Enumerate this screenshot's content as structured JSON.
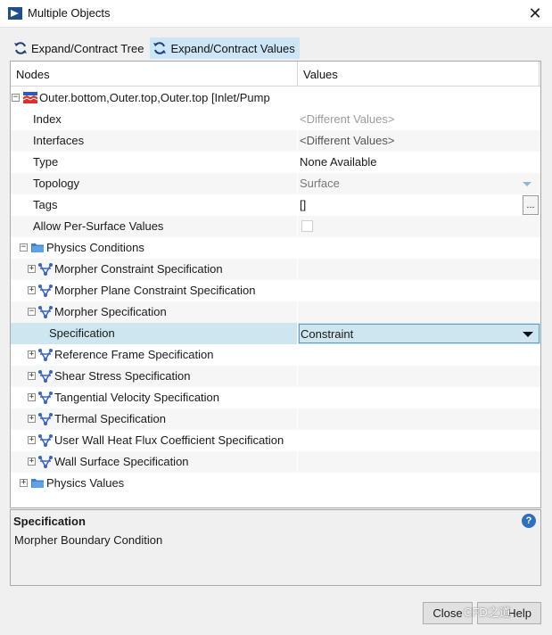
{
  "window": {
    "title": "Multiple Objects"
  },
  "toolbar": {
    "expand_tree_label": "Expand/Contract Tree",
    "expand_values_label": "Expand/Contract Values"
  },
  "columns": {
    "nodes": "Nodes",
    "values": "Values"
  },
  "tree": {
    "root_label": "Outer.bottom,Outer.top,Outer.top [Inlet/Pump",
    "index_label": "Index",
    "index_value": "<Different Values>",
    "interfaces_label": "Interfaces",
    "interfaces_value": "<Different Values>",
    "type_label": "Type",
    "type_value": "None Available",
    "topology_label": "Topology",
    "topology_value": "Surface",
    "tags_label": "Tags",
    "tags_value": "[]",
    "tags_button": "...",
    "per_surface_label": "Allow Per-Surface Values",
    "physics_conditions_label": "Physics Conditions",
    "morpher_constraint_label": "Morpher Constraint Specification",
    "morpher_plane_label": "Morpher Plane Constraint Specification",
    "morpher_spec_label": "Morpher Specification",
    "specification_label": "Specification",
    "specification_value": "Constraint",
    "ref_frame_label": "Reference Frame Specification",
    "shear_stress_label": "Shear Stress Specification",
    "tangential_label": "Tangential Velocity Specification",
    "thermal_label": "Thermal Specification",
    "user_wall_label": "User Wall Heat Flux Coefficient Specification",
    "wall_surface_label": "Wall Surface Specification",
    "physics_values_label": "Physics Values"
  },
  "description": {
    "title": "Specification",
    "text": "Morpher Boundary Condition",
    "help_icon": "?"
  },
  "buttons": {
    "close": "Close",
    "help": "Help"
  },
  "watermark": "CFD之道",
  "colors": {
    "selection": "#cde6ef",
    "accent": "#2f6fc2"
  }
}
